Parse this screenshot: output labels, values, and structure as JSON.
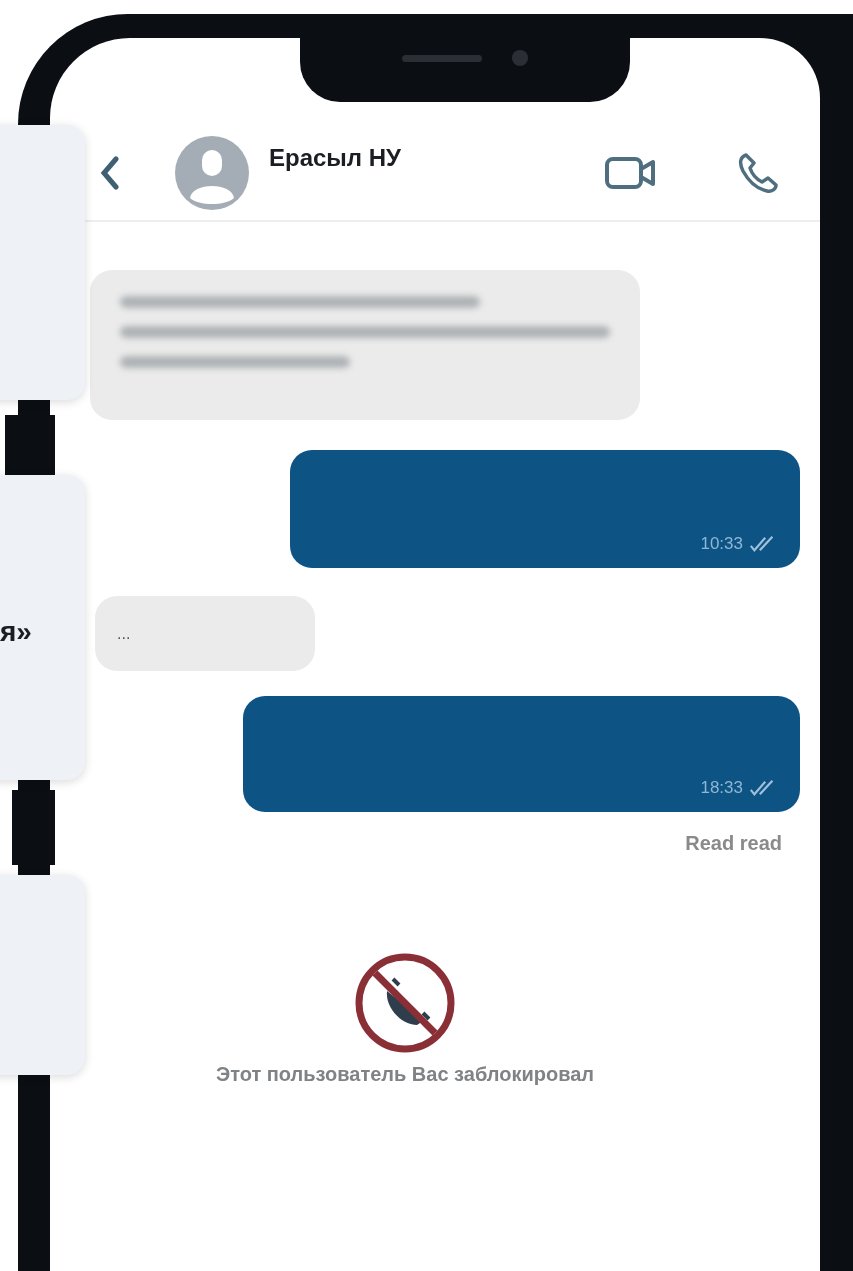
{
  "chat_header": {
    "contact_name": "Ерасыл НУ"
  },
  "messages": [
    {
      "kind": "incoming-blurred"
    },
    {
      "kind": "outgoing",
      "time": "10:33",
      "read": true
    },
    {
      "kind": "incoming",
      "text": "..."
    },
    {
      "kind": "outgoing",
      "time": "18:33",
      "read": true
    }
  ],
  "read_label": "Read read",
  "blocked_notice": "Этот пользователь Вас заблокировал",
  "side_cards": [
    {
      "kind": "blank"
    },
    {
      "kind": "text",
      "text": "я»"
    },
    {
      "kind": "blank"
    }
  ]
}
